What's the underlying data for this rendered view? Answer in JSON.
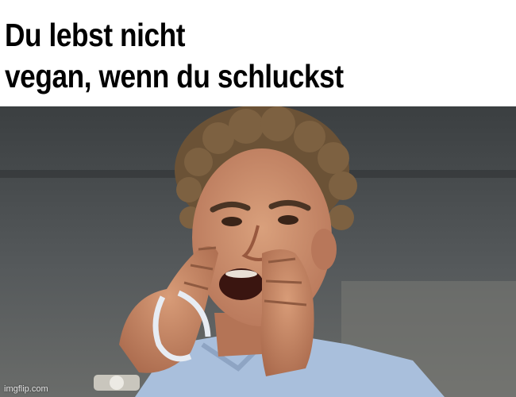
{
  "caption": {
    "line1": "Du lebst nicht",
    "line2": "vegan, wenn du schluckst"
  },
  "photo": {
    "subject": "man-shouting-with-hands-cupped"
  },
  "watermark": {
    "text": "imgflip.com"
  },
  "colors": {
    "caption_bg": "#ffffff",
    "caption_text": "#000000",
    "backdrop_dark": "#3a3e40",
    "skin": "#c98a66",
    "hair": "#6b5236",
    "shirt": "#a9bfdc"
  }
}
